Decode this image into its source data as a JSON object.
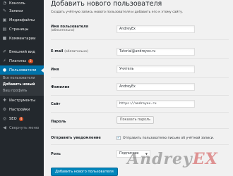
{
  "sidebar": {
    "items": [
      {
        "label": "Консоль",
        "icon": "dashboard-icon",
        "glyph": "◔"
      },
      {
        "label": "Записи",
        "icon": "pin-icon",
        "glyph": "✎"
      },
      {
        "label": "Медиафайлы",
        "icon": "media-icon",
        "glyph": "▣"
      },
      {
        "label": "Страницы",
        "icon": "page-icon",
        "glyph": "▤"
      },
      {
        "label": "Комментарии",
        "icon": "comment-icon",
        "glyph": "■"
      },
      {
        "label": "Внешний вид",
        "icon": "paintbrush-icon",
        "glyph": "✐"
      },
      {
        "label": "Плагины",
        "icon": "plugin-icon",
        "glyph": "⚡",
        "badge": "3"
      },
      {
        "label": "Пользователи",
        "icon": "users-icon",
        "glyph": "●",
        "active": true
      },
      {
        "label": "Инструменты",
        "icon": "tools-icon",
        "glyph": "✚"
      },
      {
        "label": "Настройки",
        "icon": "settings-icon",
        "glyph": "⚙"
      },
      {
        "label": "SEO",
        "icon": "seo-icon",
        "glyph": "◎",
        "badge": "4"
      },
      {
        "label": "Свернуть меню",
        "icon": "collapse-icon",
        "glyph": "◀"
      }
    ],
    "submenu": [
      "Все пользователи",
      "Добавить новый",
      "Ваш профиль"
    ]
  },
  "page": {
    "title": "Добавить нового пользователя",
    "description": "Создать учётную запись нового пользователя и добавить его к этому сайту."
  },
  "form": {
    "username_label": "Имя пользователя",
    "username_req": "(обязательно)",
    "username_value": "AndreyEx",
    "email_label": "E-mail",
    "email_req": "(обязательно)",
    "email_value": "Tutorial@andreyex.ru",
    "firstname_label": "Имя",
    "firstname_value": "Учитель",
    "lastname_label": "Фамилия",
    "lastname_value": "AndreyEx",
    "site_label": "Сайт",
    "site_value": "https://andreyex.ru",
    "password_label": "Пароль",
    "password_button": "Показать пароль",
    "notify_label": "Отправить уведомление",
    "notify_text": "Отправить пользователю письмо об учётной записи.",
    "notify_checked": true,
    "role_label": "Роль",
    "role_value": "Подписчик",
    "submit_label": "Добавить нового пользователя"
  },
  "watermark": {
    "text_main": "Andrey",
    "text_accent": "EX"
  },
  "colors": {
    "sidebar_bg": "#23282d",
    "active": "#0073aa",
    "button_primary": "#0085ba",
    "badge": "#d54e21"
  }
}
